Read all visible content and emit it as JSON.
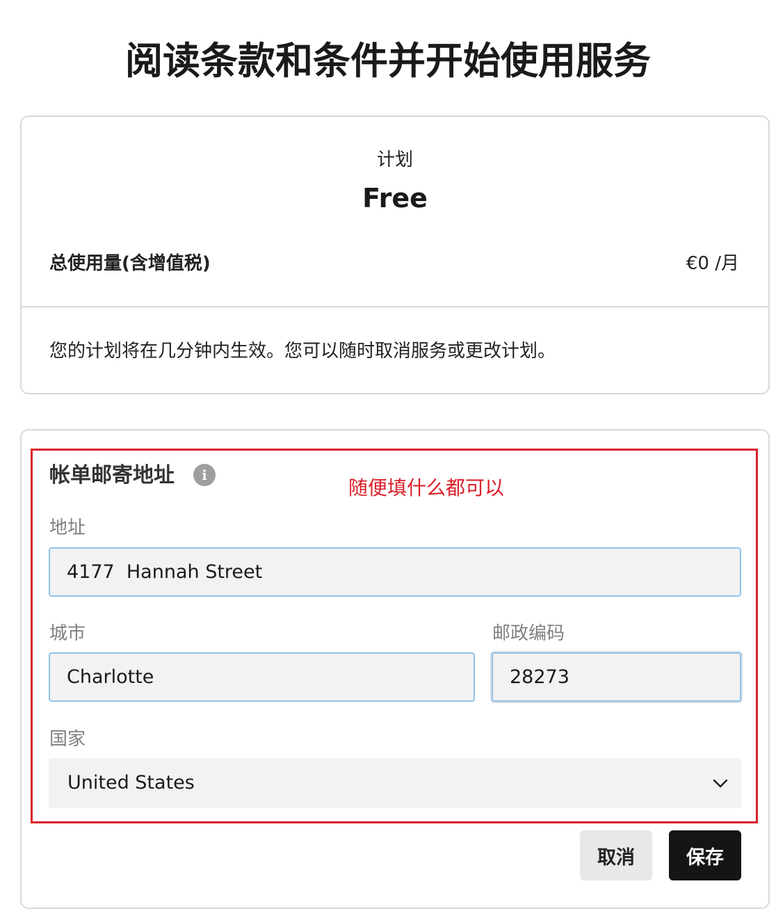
{
  "page": {
    "title": "阅读条款和条件并开始使用服务"
  },
  "plan": {
    "label": "计划",
    "name": "Free",
    "usage_label": "总使用量(含增值税)",
    "usage_price": "€0 /月",
    "note": "您的计划将在几分钟内生效。您可以随时取消服务或更改计划。"
  },
  "billing": {
    "title": "帐单邮寄地址",
    "info_icon": "info-icon",
    "annotation": "随便填什么都可以",
    "address": {
      "label": "地址",
      "value": "4177  Hannah Street"
    },
    "city": {
      "label": "城市",
      "value": "Charlotte"
    },
    "postal": {
      "label": "邮政编码",
      "value": "28273"
    },
    "country": {
      "label": "国家",
      "value": "United States"
    }
  },
  "actions": {
    "cancel_label": "取消",
    "save_label": "保存"
  },
  "colors": {
    "annotation": "#d9202a",
    "input_border": "#8fc3e8",
    "primary_button": "#151515"
  }
}
